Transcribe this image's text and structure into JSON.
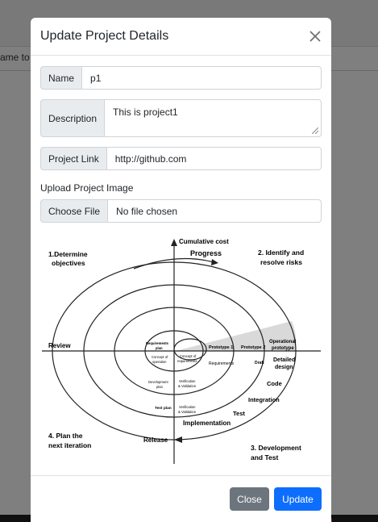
{
  "background": {
    "partial_text": "ame to"
  },
  "modal": {
    "title": "Update Project Details",
    "fields": {
      "name": {
        "label": "Name",
        "value": "p1"
      },
      "description": {
        "label": "Description",
        "value": "This is project1"
      },
      "project_link": {
        "label": "Project Link",
        "value": "http://github.com"
      }
    },
    "upload": {
      "label": "Upload Project Image",
      "button": "Choose File",
      "status": "No file chosen"
    },
    "diagram": {
      "axis_top": "Cumulative cost",
      "progress": "Progress",
      "q1_line1": "1.Determine",
      "q1_line2": "objectives",
      "q2_line1": "2. Identify and",
      "q2_line2": "resolve risks",
      "q3_line1": "3. Development",
      "q3_line2": "and Test",
      "q4_line1": "4. Plan the",
      "q4_line2": "next iteration",
      "review": "Review",
      "release": "Release",
      "implementation": "Implementation",
      "test": "Test",
      "integration": "Integration",
      "code": "Code",
      "detailed_design_1": "Detailed",
      "detailed_design_2": "design",
      "operational_1": "Operational",
      "operational_2": "prototype",
      "prototype1": "Prototype 1",
      "prototype2": "Prototype 2",
      "draft": "Draft",
      "requirements": "Requirements",
      "req_plan_1": "Requirements",
      "req_plan_2": "plan",
      "concept_op_1": "Concept of",
      "concept_op_2": "operation",
      "concept_req_1": "Concept of",
      "concept_req_2": "requirements",
      "dev_plan_1": "Development",
      "dev_plan_2": "plan",
      "vv1_1": "Verification",
      "vv1_2": "& Validation",
      "test_plan": "Test plan",
      "vv2_1": "Verification",
      "vv2_2": "& Validation"
    },
    "buttons": {
      "close": "Close",
      "update": "Update"
    }
  },
  "colors": {
    "primary": "#0d6efd",
    "secondary": "#6c757d",
    "backdrop": "#4a4a4a"
  }
}
